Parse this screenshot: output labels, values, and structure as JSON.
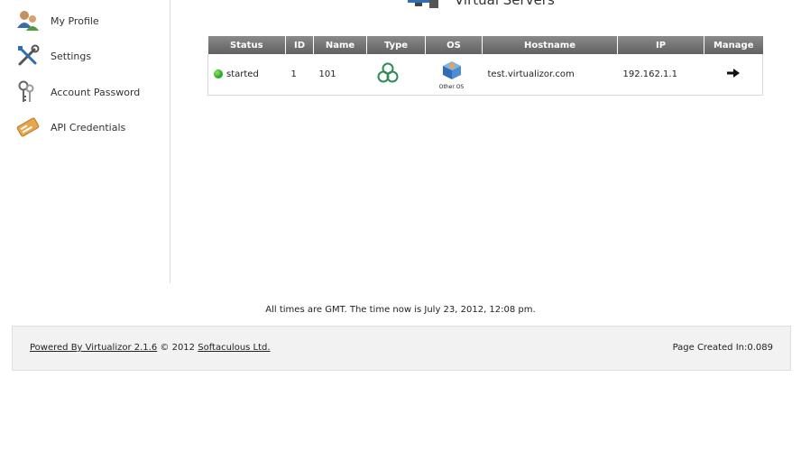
{
  "sidebar": {
    "items": [
      {
        "label": "My Profile",
        "icon": "users-icon"
      },
      {
        "label": "Settings",
        "icon": "tools-icon"
      },
      {
        "label": "Account Password",
        "icon": "keys-icon"
      },
      {
        "label": "API Credentials",
        "icon": "credentials-icon"
      }
    ]
  },
  "header": {
    "title": "Virtual Servers",
    "icon": "server-monitor-icon"
  },
  "table": {
    "columns": [
      "Status",
      "ID",
      "Name",
      "Type",
      "OS",
      "Hostname",
      "IP",
      "Manage"
    ],
    "rows": [
      {
        "status": "started",
        "status_color": "#2fae23",
        "id": "1",
        "name": "101",
        "type_icon": "openvz-icon",
        "os_label": "Other OS",
        "os_icon": "other-os-icon",
        "hostname": "test.virtualizor.com",
        "ip": "192.162.1.1",
        "manage_icon": "arrow-right-icon"
      }
    ]
  },
  "time_note": "All times are GMT. The time now is July 23, 2012, 12:08 pm.",
  "footer": {
    "powered_by": "Powered By Virtualizor 2.1.6",
    "copyright": "© 2012",
    "company": "Softaculous Ltd.",
    "page_created": "Page Created In:0.089"
  },
  "colors": {
    "table_header": "#6e6e6e",
    "status_started": "#2fae23",
    "footer_bg": "#f2f2f2"
  }
}
